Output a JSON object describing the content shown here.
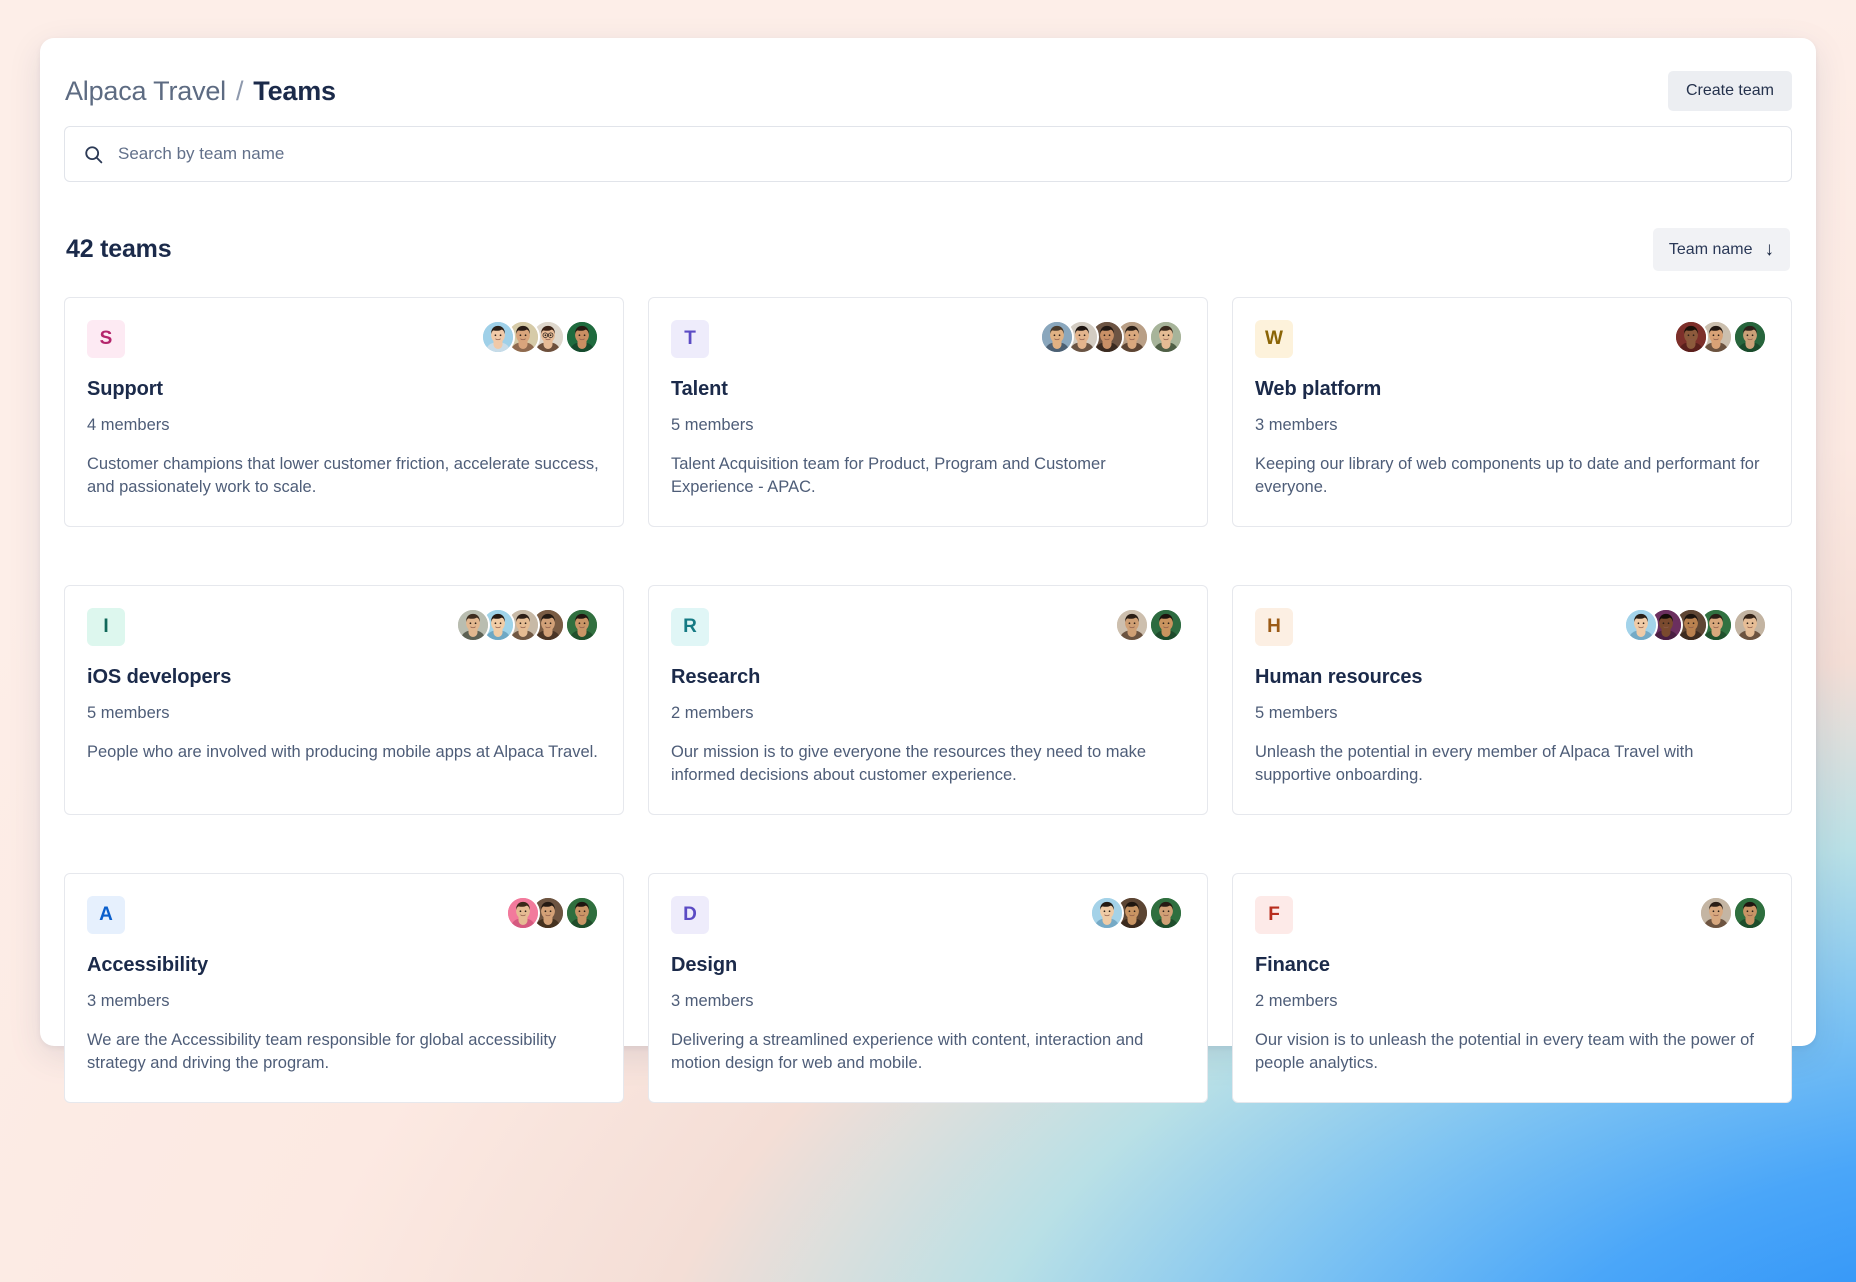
{
  "header": {
    "breadcrumb_root": "Alpaca Travel",
    "breadcrumb_separator": "/",
    "breadcrumb_current": "Teams",
    "create_team_label": "Create team"
  },
  "search": {
    "placeholder": "Search by team name",
    "value": "",
    "icon": "search-icon"
  },
  "list_meta": {
    "count_label": "42 teams",
    "sort_label": "Team name",
    "sort_direction_icon": "arrow-down-icon",
    "sort_direction_glyph": "↓"
  },
  "teams": [
    {
      "initial": "S",
      "name": "Support",
      "members_label": "4 members",
      "description": "Customer champions that lower customer friction, accelerate success, and passionately work to scale.",
      "avatar_bg": "#fdeaf3",
      "avatar_fg": "#b4246b",
      "member_avatars": [
        {
          "skin": "#f0c9a8",
          "hair": "#2b2019",
          "bg": "#9fd0e8",
          "shirt": "#c8dce8"
        },
        {
          "skin": "#d9a57c",
          "hair": "#2a1d16",
          "bg": "#d6cba8",
          "shirt": "#8f6a4f"
        },
        {
          "skin": "#e7bb96",
          "hair": "#3b2317",
          "bg": "#ded7cc",
          "shirt": "#6d4f3c",
          "glasses": true
        },
        {
          "skin": "#c98f63",
          "hair": "#241a12",
          "bg": "#1f6b3e",
          "shirt": "#164a2d"
        }
      ]
    },
    {
      "initial": "T",
      "name": "Talent",
      "members_label": "5 members",
      "description": "Talent Acquisition team for Product, Program and Customer Experience - APAC.",
      "avatar_bg": "#eeecfb",
      "avatar_fg": "#5b4bc4",
      "member_avatars": [
        {
          "skin": "#e0b183",
          "hair": "#4a3b2c",
          "bg": "#8aa7bd",
          "shirt": "#4c6073"
        },
        {
          "skin": "#e3b48d",
          "hair": "#1d1410",
          "bg": "#d3ccc2",
          "shirt": "#6a5444"
        },
        {
          "skin": "#c99066",
          "hair": "#221813",
          "bg": "#6d5443",
          "shirt": "#3b2b21"
        },
        {
          "skin": "#d9a87e",
          "hair": "#2b1f17",
          "bg": "#b99f86",
          "shirt": "#5d4534"
        },
        {
          "skin": "#e4bb94",
          "hair": "#3a2a1d",
          "bg": "#a7b49a",
          "shirt": "#4f5f46"
        }
      ]
    },
    {
      "initial": "W",
      "name": "Web platform",
      "members_label": "3 members",
      "description": "Keeping our library of web components up to date and performant for everyone.",
      "avatar_bg": "#fdf2db",
      "avatar_fg": "#8a6406",
      "member_avatars": [
        {
          "skin": "#8c5a3c",
          "hair": "#1a1008",
          "bg": "#7d2f2a",
          "shirt": "#5a1f1c"
        },
        {
          "skin": "#d8a276",
          "hair": "#221711",
          "bg": "#cbbfae",
          "shirt": "#6b523f"
        },
        {
          "skin": "#caa077",
          "hair": "#2d2019",
          "bg": "#27653c",
          "shirt": "#1a4a2b"
        }
      ]
    },
    {
      "initial": "I",
      "name": "iOS developers",
      "members_label": "5 members",
      "description": "People who are involved with producing mobile apps at Alpaca Travel.",
      "avatar_bg": "#ddf7ee",
      "avatar_fg": "#11685a",
      "member_avatars": [
        {
          "skin": "#e2b78f",
          "hair": "#3d2c1f",
          "bg": "#b9bdb0",
          "shirt": "#5d6154"
        },
        {
          "skin": "#f1cda6",
          "hair": "#241a13",
          "bg": "#9fd3e8",
          "shirt": "#6ea8c4"
        },
        {
          "skin": "#e5bc93",
          "hair": "#2c1e16",
          "bg": "#c7b9a6",
          "shirt": "#6f5743"
        },
        {
          "skin": "#d2a178",
          "hair": "#241a13",
          "bg": "#7a5c44",
          "shirt": "#4a3526"
        },
        {
          "skin": "#c99566",
          "hair": "#201610",
          "bg": "#31703f",
          "shirt": "#20502c"
        }
      ]
    },
    {
      "initial": "R",
      "name": "Research",
      "members_label": "2 members",
      "description": "Our mission is to give everyone the resources they need to make informed decisions about customer experience.",
      "avatar_bg": "#e0f6f6",
      "avatar_fg": "#157a84",
      "member_avatars": [
        {
          "skin": "#cf9f74",
          "hair": "#2a1d15",
          "bg": "#cdbfae",
          "shirt": "#6b5340"
        },
        {
          "skin": "#c9945f",
          "hair": "#1d140e",
          "bg": "#2d6b40",
          "shirt": "#1e4b2c"
        }
      ]
    },
    {
      "initial": "H",
      "name": "Human resources",
      "members_label": "5 members",
      "description": "Unleash the potential in every member of Alpaca Travel with supportive onboarding.",
      "avatar_bg": "#fcefe3",
      "avatar_fg": "#9b5a16",
      "member_avatars": [
        {
          "skin": "#f0cba7",
          "hair": "#2a1f18",
          "bg": "#a3d3ea",
          "shirt": "#74aac6"
        },
        {
          "skin": "#7a4a2e",
          "hair": "#140c07",
          "bg": "#6b2f5f",
          "shirt": "#4a1f42"
        },
        {
          "skin": "#b9814f",
          "hair": "#1c130d",
          "bg": "#5f4634",
          "shirt": "#3d2c20"
        },
        {
          "skin": "#d9a87c",
          "hair": "#2b1e16",
          "bg": "#327241",
          "shirt": "#21512d"
        },
        {
          "skin": "#e6bd96",
          "hair": "#352418",
          "bg": "#c3b4a2",
          "shirt": "#6c5340"
        }
      ]
    },
    {
      "initial": "A",
      "name": "Accessibility",
      "members_label": "3 members",
      "description": "We are the Accessibility team responsible for global accessibility strategy and driving the program.",
      "avatar_bg": "#e6f0fd",
      "avatar_fg": "#0b5fcc",
      "member_avatars": [
        {
          "skin": "#e5bb93",
          "hair": "#3a2819",
          "bg": "#f27a9c",
          "shirt": "#d55a80"
        },
        {
          "skin": "#d3a177",
          "hair": "#241a13",
          "bg": "#6d5441",
          "shirt": "#45321f"
        },
        {
          "skin": "#c99566",
          "hair": "#1f1610",
          "bg": "#2f6f3e",
          "shirt": "#1f4d2b"
        }
      ]
    },
    {
      "initial": "D",
      "name": "Design",
      "members_label": "3 members",
      "description": "Delivering a streamlined experience with content, interaction and motion design for web and mobile.",
      "avatar_bg": "#eeecfb",
      "avatar_fg": "#5b4bc4",
      "member_avatars": [
        {
          "skin": "#efcba6",
          "hair": "#241a13",
          "bg": "#a4d2e8",
          "shirt": "#76aac6"
        },
        {
          "skin": "#c89463",
          "hair": "#1f160f",
          "bg": "#5c4533",
          "shirt": "#3a2a1e"
        },
        {
          "skin": "#d0a075",
          "hair": "#261b13",
          "bg": "#2f6f3f",
          "shirt": "#1f4e2c"
        }
      ]
    },
    {
      "initial": "F",
      "name": "Finance",
      "members_label": "2 members",
      "description": "Our vision is to unleash the potential in every team with the power of people analytics.",
      "avatar_bg": "#fdeae8",
      "avatar_fg": "#b82d1e",
      "member_avatars": [
        {
          "skin": "#d8a87f",
          "hair": "#2b1f17",
          "bg": "#c4b5a3",
          "shirt": "#6d5441"
        },
        {
          "skin": "#c99566",
          "hair": "#1f1610",
          "bg": "#2e6f3e",
          "shirt": "#1e4d2b"
        }
      ]
    }
  ]
}
